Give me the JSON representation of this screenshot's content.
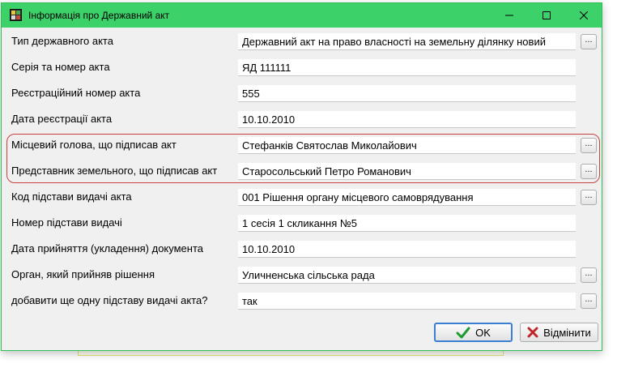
{
  "window": {
    "title": "Інформація про Державний акт"
  },
  "fields": [
    {
      "label": "Тип державного акта",
      "value": "Державний акт на право власності на земельну ділянку новий",
      "has_picker": true
    },
    {
      "label": "Серія та номер акта",
      "value": "ЯД 111111",
      "has_picker": false
    },
    {
      "label": "Реєстраційний номер акта",
      "value": "555",
      "has_picker": false
    },
    {
      "label": "Дата реєстрації акта",
      "value": "10.10.2010",
      "has_picker": false
    },
    {
      "label": "Місцевий голова, що підписав акт",
      "value": "Стефанків Святослав Миколайович",
      "has_picker": true
    },
    {
      "label": "Представник земельного, що підписав акт",
      "value": "Старосольський Петро Романович",
      "has_picker": true
    },
    {
      "label": "Код підстави видачі акта",
      "value": "001 Рішення органу місцевого самоврядування",
      "has_picker": true
    },
    {
      "label": "Номер підстави видачі",
      "value": "1 сесія 1 скликання №5",
      "has_picker": false
    },
    {
      "label": "Дата прийняття (укладення) документа",
      "value": "10.10.2010",
      "has_picker": false
    },
    {
      "label": "Орган, який прийняв рішення",
      "value": "Уличненська сільська рада",
      "has_picker": true
    },
    {
      "label": "добавити ще одну підставу видачі акта?",
      "value": "так",
      "has_picker": true
    }
  ],
  "picker_label": "...",
  "buttons": {
    "ok_label": "OK",
    "cancel_label": "Відмінити"
  },
  "icons": {
    "app": "app-icon",
    "minimize": "minimize-icon",
    "maximize": "maximize-icon",
    "close": "close-icon",
    "ok": "checkmark-icon",
    "cancel": "cross-icon"
  },
  "colors": {
    "titlebar": "#3dd16a",
    "window_border": "#2fbf57",
    "highlight_border": "#c8413f",
    "ok_check": "#1e9b2e",
    "cancel_cross": "#c0272d"
  }
}
